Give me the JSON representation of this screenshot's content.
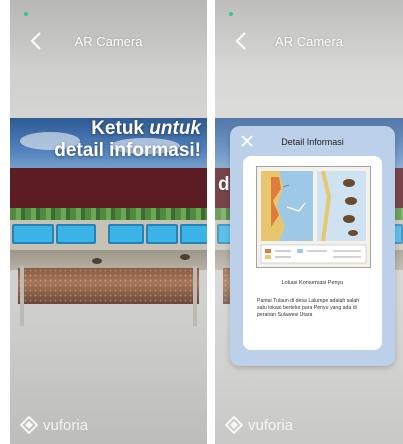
{
  "screens": [
    {
      "header": {
        "title": "AR Camera"
      },
      "ar_label": {
        "line1_bold": "Ketuk ",
        "line1_italic": "untuk",
        "line2": "detail informasi!"
      },
      "footer": {
        "brand": "vuforia"
      }
    },
    {
      "header": {
        "title": "AR Camera"
      },
      "ar_label_partial": "d",
      "modal": {
        "title": "Detail Informasi",
        "caption": "Lokasi Konservasi Penyu",
        "description": "Pantai Tulaun di desa Lalumpe adalah salah satu lokasi bertelur para Penyu yang ada di perairan Sulawesi Utara"
      },
      "footer": {
        "brand": "vuforia"
      }
    }
  ],
  "colors": {
    "banner": "#5b1c24",
    "modal_bg": "#bcd0ea",
    "pool": "#3ab3e6",
    "status": "#3cc58c"
  }
}
